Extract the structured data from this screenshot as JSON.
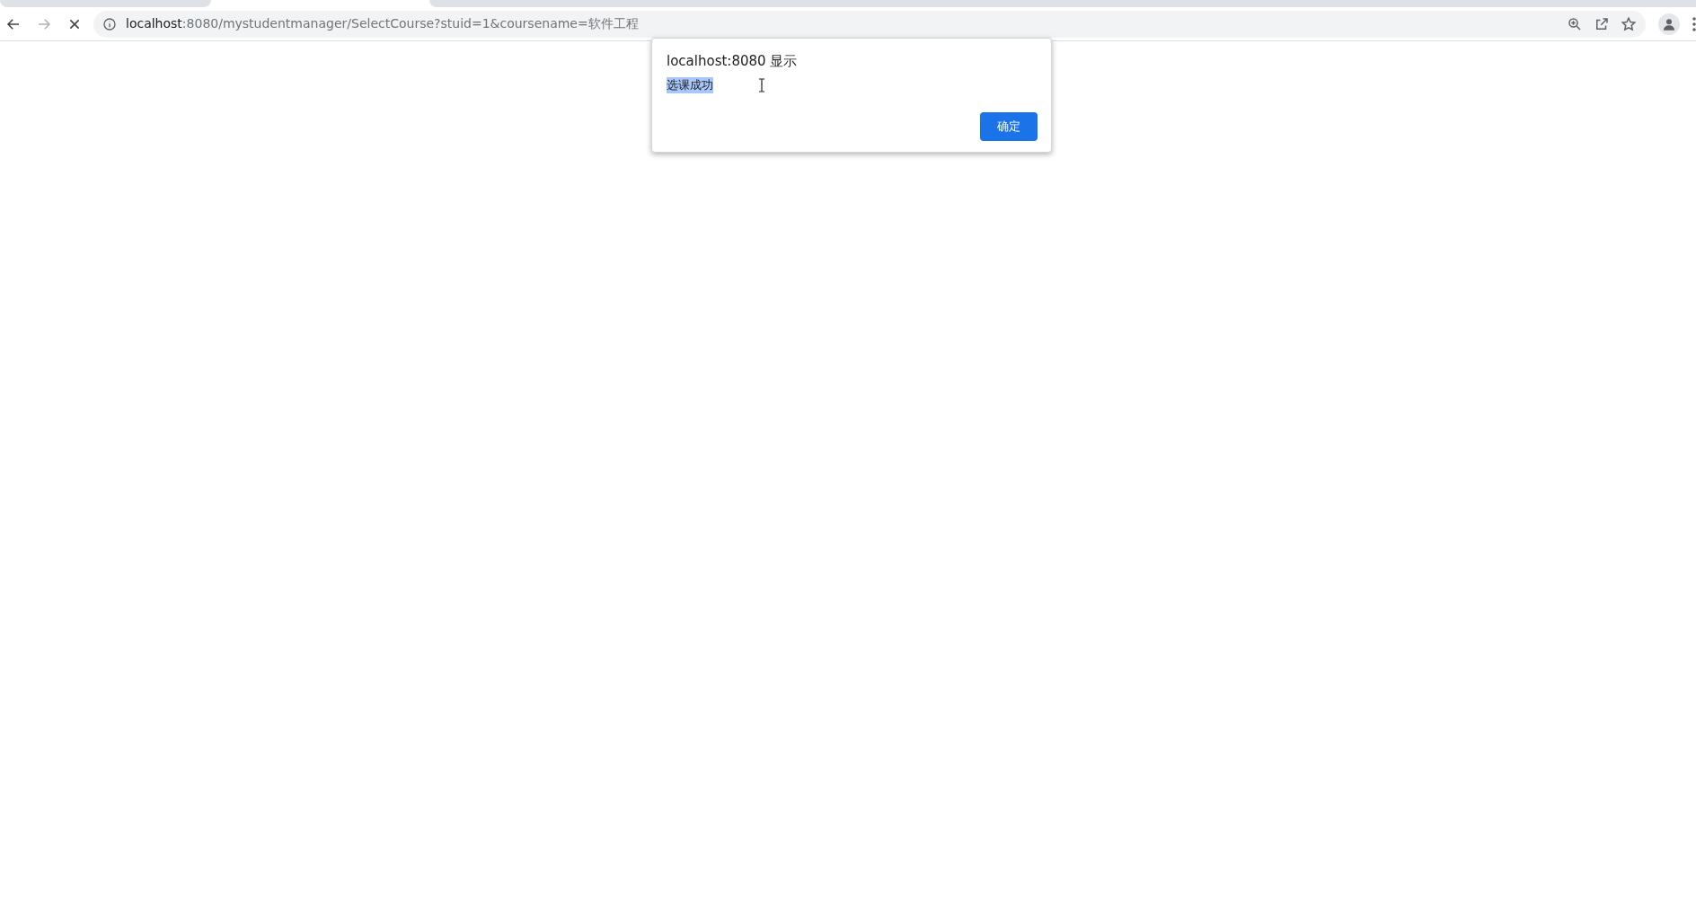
{
  "address_bar": {
    "host": "localhost",
    "rest": ":8080/mystudentmanager/SelectCourse?stuid=1&coursename=软件工程"
  },
  "dialog": {
    "title": "localhost:8080 显示",
    "message": {
      "text": "选课成功",
      "selected": true
    },
    "button": "确定"
  }
}
